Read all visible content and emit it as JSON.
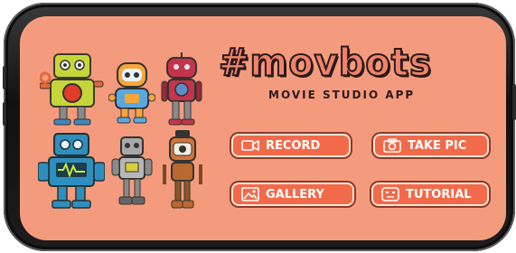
{
  "app": {
    "logo_text": "#movbots",
    "subtitle": "MOVIE STUDIO APP"
  },
  "buttons": {
    "record": "RECORD",
    "take_pic": "TAKE PIC",
    "gallery": "GALLERY",
    "tutorial": "TUTORIAL"
  },
  "icons": {
    "record": "video-camera-icon",
    "take_pic": "camera-icon",
    "gallery": "image-icon",
    "tutorial": "robot-face-icon"
  },
  "colors": {
    "screen_background": "#f59b7d",
    "button_fill": "#f26a4a",
    "logo_fill": "#f0836a",
    "text_dark": "#2a1a1c"
  }
}
